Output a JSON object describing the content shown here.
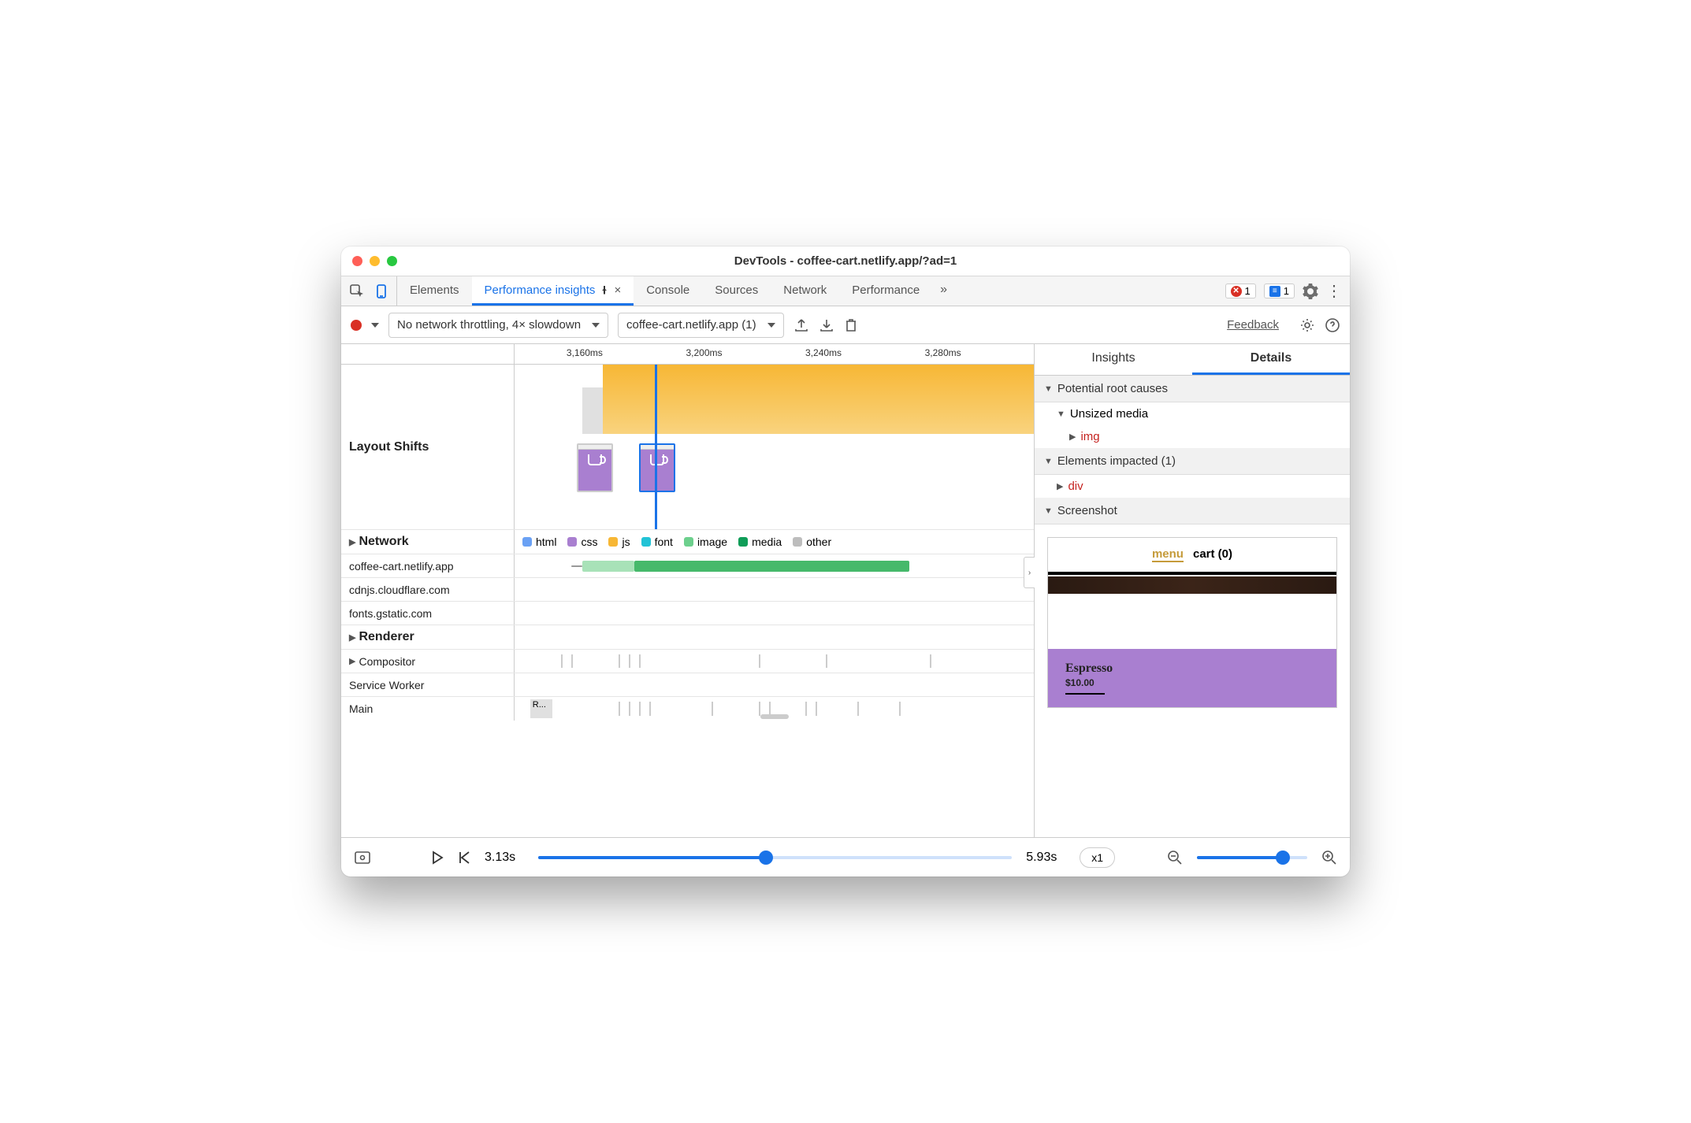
{
  "window": {
    "title": "DevTools - coffee-cart.netlify.app/?ad=1"
  },
  "tabs": {
    "items": [
      "Elements",
      "Performance insights",
      "Console",
      "Sources",
      "Network",
      "Performance"
    ],
    "active_index": 1,
    "error_badge": "1",
    "info_badge": "1"
  },
  "toolbar": {
    "throttling": "No network throttling, 4× slowdown",
    "page_select": "coffee-cart.netlify.app (1)",
    "feedback": "Feedback"
  },
  "ruler": [
    "3,160ms",
    "3,200ms",
    "3,240ms",
    "3,280ms"
  ],
  "rows": {
    "layout_shifts": "Layout Shifts",
    "network": "Network",
    "network_hosts": [
      "coffee-cart.netlify.app",
      "cdnjs.cloudflare.com",
      "fonts.gstatic.com"
    ],
    "renderer": "Renderer",
    "renderer_items": [
      "Compositor",
      "Service Worker",
      "Main"
    ],
    "main_block_label": "R..."
  },
  "legend": {
    "html": "html",
    "css": "css",
    "js": "js",
    "font": "font",
    "image": "image",
    "media": "media",
    "other": "other"
  },
  "details": {
    "tabs": [
      "Insights",
      "Details"
    ],
    "active": 1,
    "sections": {
      "root_causes": "Potential root causes",
      "unsized_media": "Unsized media",
      "img": "img",
      "elements_impacted": "Elements impacted (1)",
      "div": "div",
      "screenshot": "Screenshot"
    },
    "preview": {
      "menu": "menu",
      "cart": "cart (0)",
      "product": "Espresso",
      "price": "$10.00"
    }
  },
  "footer": {
    "start": "3.13s",
    "end": "5.93s",
    "speed": "x1"
  }
}
